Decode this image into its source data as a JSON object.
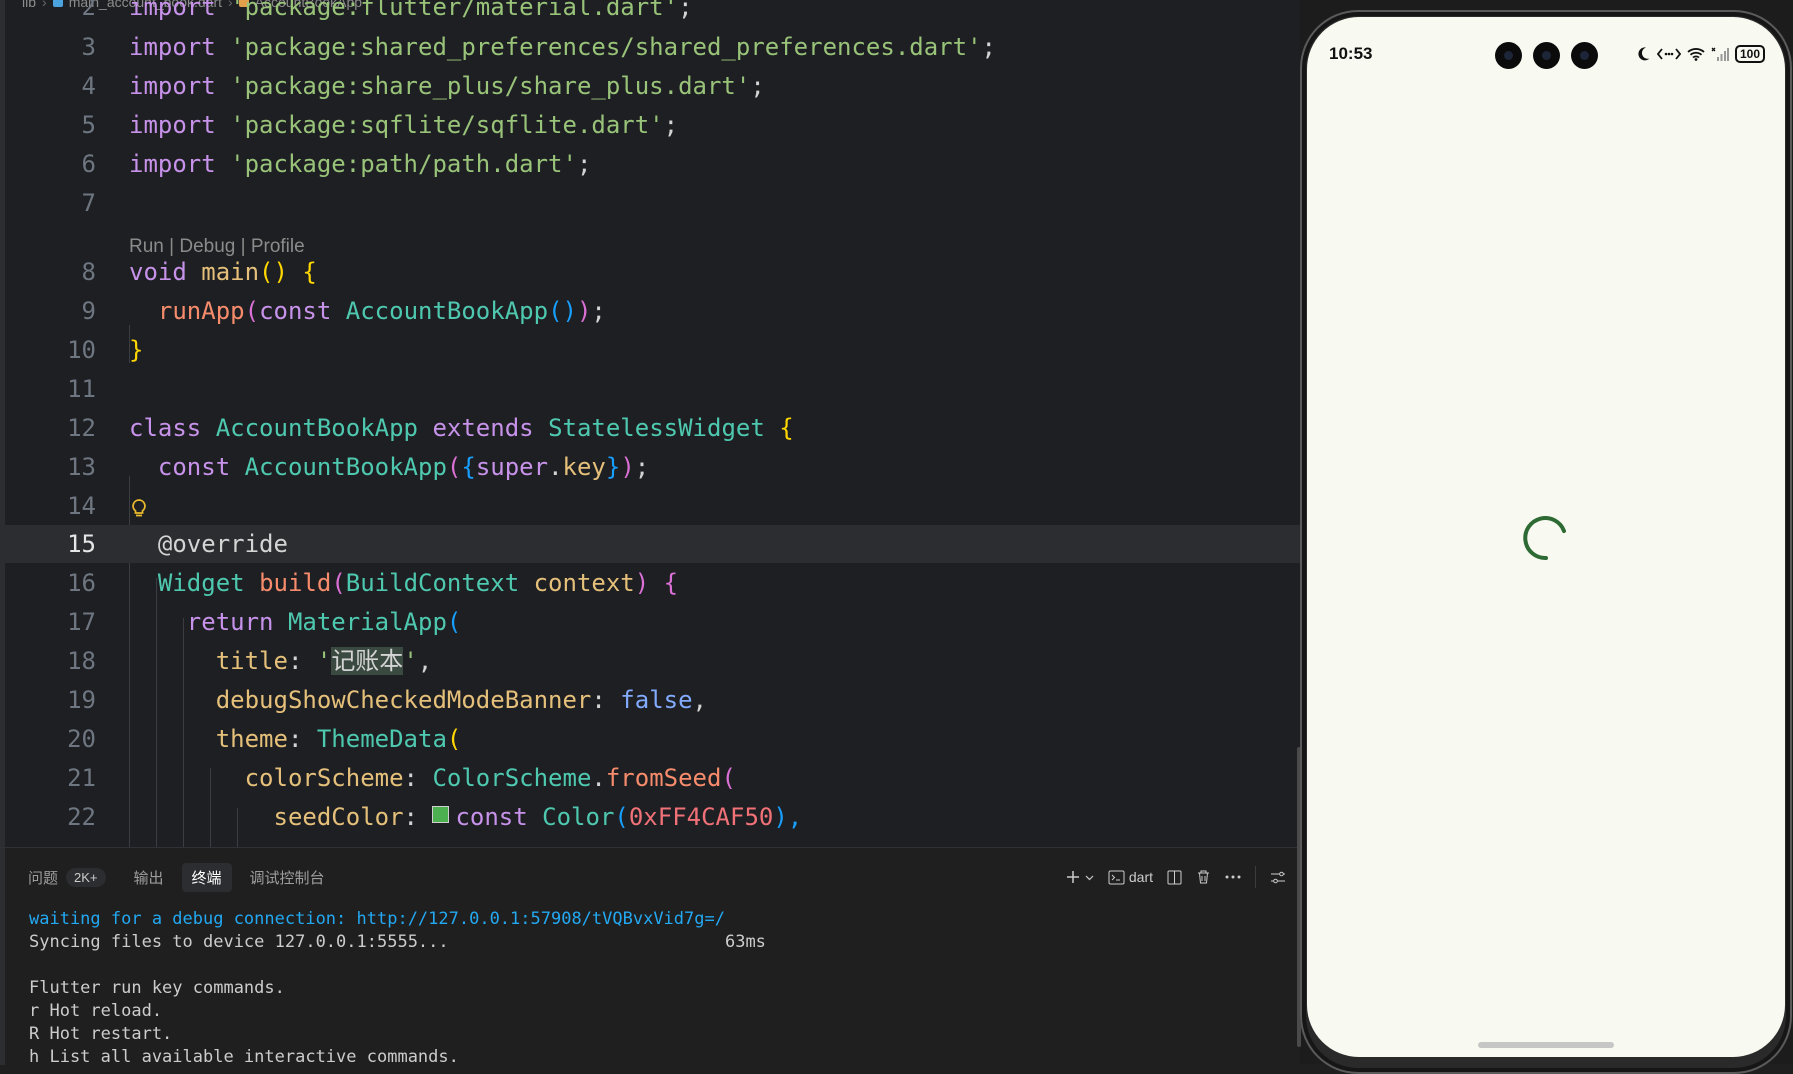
{
  "breadcrumb": {
    "folder": "lib",
    "file": "main_account_book.dart",
    "symbol": "AccountBookApp"
  },
  "codelens": "Run | Debug | Profile",
  "lines": [
    {
      "n": "2",
      "tokens": [
        [
          "import",
          "kw"
        ],
        [
          " 'package:flutter/material.dart'",
          "str"
        ],
        [
          ";",
          "sep"
        ]
      ]
    },
    {
      "n": "3",
      "tokens": [
        [
          "import",
          "kw"
        ],
        [
          " ",
          "sep"
        ],
        [
          "'package:shared_preferences/shared_preferences.dart'",
          "str"
        ],
        [
          ";",
          "sep"
        ]
      ]
    },
    {
      "n": "4",
      "tokens": [
        [
          "import",
          "kw"
        ],
        [
          " ",
          "sep"
        ],
        [
          "'package:share_plus/share_plus.dart'",
          "str"
        ],
        [
          ";",
          "sep"
        ]
      ]
    },
    {
      "n": "5",
      "tokens": [
        [
          "import",
          "kw"
        ],
        [
          " ",
          "sep"
        ],
        [
          "'package:sqflite/sqflite.dart'",
          "str"
        ],
        [
          ";",
          "sep"
        ]
      ]
    },
    {
      "n": "6",
      "tokens": [
        [
          "import",
          "kw"
        ],
        [
          " ",
          "sep"
        ],
        [
          "'package:path/path.dart'",
          "str"
        ],
        [
          ";",
          "sep"
        ]
      ]
    },
    {
      "n": "7",
      "tokens": []
    },
    {
      "n": "8",
      "tokens": [
        [
          "void",
          "kw"
        ],
        [
          " ",
          "sep"
        ],
        [
          "main",
          "var"
        ],
        [
          "()",
          "b1"
        ],
        [
          " ",
          "sep"
        ],
        [
          "{",
          "b1"
        ]
      ]
    },
    {
      "n": "9",
      "tokens": [
        [
          "  ",
          "sep"
        ],
        [
          "runApp",
          "fn"
        ],
        [
          "(",
          "b2"
        ],
        [
          "const",
          "kw"
        ],
        [
          " ",
          "sep"
        ],
        [
          "AccountBookApp",
          "type"
        ],
        [
          "()",
          "b3"
        ],
        [
          ")",
          "b2"
        ],
        [
          ";",
          "sep"
        ]
      ]
    },
    {
      "n": "10",
      "tokens": [
        [
          "}",
          "b1"
        ]
      ]
    },
    {
      "n": "11",
      "tokens": []
    },
    {
      "n": "12",
      "tokens": [
        [
          "class",
          "kw"
        ],
        [
          " ",
          "sep"
        ],
        [
          "AccountBookApp",
          "type"
        ],
        [
          " ",
          "sep"
        ],
        [
          "extends",
          "kw"
        ],
        [
          " ",
          "sep"
        ],
        [
          "StatelessWidget",
          "type"
        ],
        [
          " ",
          "sep"
        ],
        [
          "{",
          "b1"
        ]
      ]
    },
    {
      "n": "13",
      "tokens": [
        [
          "  ",
          "sep"
        ],
        [
          "const",
          "kw"
        ],
        [
          " ",
          "sep"
        ],
        [
          "AccountBookApp",
          "type"
        ],
        [
          "(",
          "b2"
        ],
        [
          "{",
          "b3"
        ],
        [
          "super",
          "kw"
        ],
        [
          ".",
          "sep"
        ],
        [
          "key",
          "var"
        ],
        [
          "}",
          "b3"
        ],
        [
          ")",
          "b2"
        ],
        [
          ";",
          "sep"
        ]
      ]
    },
    {
      "n": "14",
      "tokens": []
    },
    {
      "n": "15",
      "tokens": [
        [
          "  ",
          "sep"
        ],
        [
          "@override",
          "ann"
        ]
      ]
    },
    {
      "n": "16",
      "tokens": [
        [
          "  ",
          "sep"
        ],
        [
          "Widget",
          "type"
        ],
        [
          " ",
          "sep"
        ],
        [
          "build",
          "fn"
        ],
        [
          "(",
          "b2"
        ],
        [
          "BuildContext",
          "type"
        ],
        [
          " ",
          "sep"
        ],
        [
          "context",
          "var"
        ],
        [
          ")",
          "b2"
        ],
        [
          " ",
          "sep"
        ],
        [
          "{",
          "b2"
        ]
      ]
    },
    {
      "n": "17",
      "tokens": [
        [
          "    ",
          "sep"
        ],
        [
          "return",
          "kw"
        ],
        [
          " ",
          "sep"
        ],
        [
          "MaterialApp",
          "type"
        ],
        [
          "(",
          "b3"
        ]
      ]
    },
    {
      "n": "18",
      "tokens": [
        [
          "      ",
          "sep"
        ],
        [
          "title",
          "var"
        ],
        [
          ": ",
          "sep"
        ],
        [
          "'",
          "str"
        ],
        [
          "记账本",
          "hl"
        ],
        [
          "'",
          "str"
        ],
        [
          ",",
          "sep"
        ]
      ]
    },
    {
      "n": "19",
      "tokens": [
        [
          "      ",
          "sep"
        ],
        [
          "debugShowCheckedModeBanner",
          "var"
        ],
        [
          ": ",
          "sep"
        ],
        [
          "false",
          "bool"
        ],
        [
          ",",
          "sep"
        ]
      ]
    },
    {
      "n": "20",
      "tokens": [
        [
          "      ",
          "sep"
        ],
        [
          "theme",
          "var"
        ],
        [
          ": ",
          "sep"
        ],
        [
          "ThemeData",
          "type"
        ],
        [
          "(",
          "b1"
        ]
      ]
    },
    {
      "n": "21",
      "tokens": [
        [
          "        ",
          "sep"
        ],
        [
          "colorScheme",
          "var"
        ],
        [
          ": ",
          "sep"
        ],
        [
          "ColorScheme",
          "type"
        ],
        [
          ".",
          "sep"
        ],
        [
          "fromSeed",
          "fn"
        ],
        [
          "(",
          "b2"
        ]
      ]
    },
    {
      "n": "22",
      "tokens": [
        [
          "          ",
          "sep"
        ],
        [
          "seedColor",
          "var"
        ],
        [
          ": ",
          "sep"
        ],
        [
          "",
          "swatch"
        ],
        [
          "const",
          "kw"
        ],
        [
          " ",
          "sep"
        ],
        [
          "Color",
          "type"
        ],
        [
          "(",
          "b3"
        ],
        [
          "0xFF4CAF50",
          "num"
        ],
        [
          "),",
          "b3"
        ]
      ]
    }
  ],
  "current_line": "15",
  "panel": {
    "tabs": [
      {
        "label": "问题",
        "badge": "2K+"
      },
      {
        "label": "输出"
      },
      {
        "label": "终端"
      },
      {
        "label": "调试控制台"
      }
    ],
    "active_tab": "终端",
    "terminal_name": "dart",
    "terminal": [
      {
        "text": "waiting for a debug connection: http://127.0.0.1:57908/tVQBvxVid7g=/",
        "link": true
      },
      {
        "text": "Syncing files to device 127.0.0.1:5555...                           63ms"
      },
      {
        "text": ""
      },
      {
        "text": "Flutter run key commands."
      },
      {
        "text": "r Hot reload."
      },
      {
        "text": "R Hot restart."
      },
      {
        "text": "h List all available interactive commands."
      }
    ]
  },
  "phone": {
    "time": "10:53",
    "battery": "100",
    "accent": "#2e6b34"
  }
}
